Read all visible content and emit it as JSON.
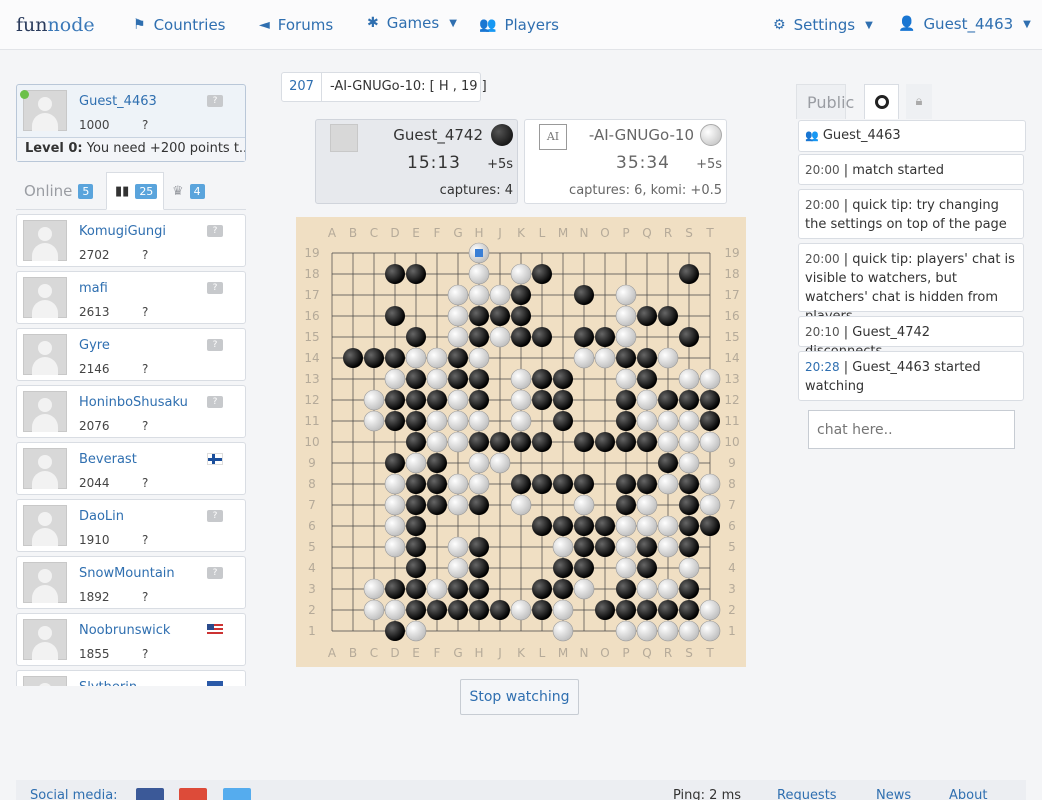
{
  "nav": {
    "logo_a": "fun",
    "logo_b": "node",
    "countries": "Countries",
    "forums": "Forums",
    "games": "Games",
    "players": "Players",
    "settings": "Settings",
    "user": "Guest_4463"
  },
  "me": {
    "name": "Guest_4463",
    "rating": "1000",
    "q": "?",
    "badge": "?",
    "level": "Level 0:",
    "level_text": "You need +200 points t..."
  },
  "tabs": {
    "online": "Online",
    "online_count": "5",
    "ranked_count": "25",
    "crown_count": "4"
  },
  "players": [
    {
      "name": "KomugiGungi",
      "rating": "2702",
      "q": "?",
      "flag": "none"
    },
    {
      "name": "mafi",
      "rating": "2613",
      "q": "?",
      "flag": "none"
    },
    {
      "name": "Gyre",
      "rating": "2146",
      "q": "?",
      "flag": "none"
    },
    {
      "name": "HoninboShusaku",
      "rating": "2076",
      "q": "?",
      "flag": "none"
    },
    {
      "name": "Beverast",
      "rating": "2044",
      "q": "?",
      "flag": "fi"
    },
    {
      "name": "DaoLin",
      "rating": "1910",
      "q": "?",
      "flag": "none"
    },
    {
      "name": "SnowMountain",
      "rating": "1892",
      "q": "?",
      "flag": "none"
    },
    {
      "name": "Noobrunswick",
      "rating": "1855",
      "q": "?",
      "flag": "us"
    },
    {
      "name": "Slytherin",
      "rating": "",
      "q": "",
      "flag": "ua"
    }
  ],
  "game": {
    "move_no": "207",
    "last_move": "-AI-GNUGo-10: [ H , 19 ]",
    "black": {
      "name": "Guest_4742",
      "time": "15:13",
      "inc": "+5s",
      "captures": "captures: 4"
    },
    "white": {
      "name": "-AI-GNUGo-10",
      "time": "35:34",
      "inc": "+5s",
      "captures": "captures: 6, komi: +0.5"
    },
    "stop": "Stop watching",
    "cols": [
      "A",
      "B",
      "C",
      "D",
      "E",
      "F",
      "G",
      "H",
      "J",
      "K",
      "L",
      "M",
      "N",
      "O",
      "P",
      "Q",
      "R",
      "S",
      "T"
    ],
    "rows": [
      "19",
      "18",
      "17",
      "16",
      "15",
      "14",
      "13",
      "12",
      "11",
      "10",
      "9",
      "8",
      "7",
      "6",
      "5",
      "4",
      "3",
      "2",
      "1"
    ],
    "board": [
      "...................",
      "...BB..W.WB......B.",
      "......WWWB..B.W....",
      "...B..WBBB....WBB..",
      "....B.WBWBB.BBW..B.",
      ".BBBWWBW....WWBBW..",
      "...WBWBB.WBB..WB.WWW.",
      "..WBBBWB.WBB..BWBBBB",
      "..WBBWWW.W.B..BWWWBW",
      "....BWWBBBB.BBBBWWWW",
      "...BWB.WW.......BW.W",
      "...WBBWW.BBBB.BBWBWB",
      "...WBBWB.W..W.BW.BW.",
      "...WB.....BBBBWWWBB.",
      "...WB.WB...WBBWBWB..",
      "....B.WB...BB.WB.W..",
      "..WBBWBB..BBW.BWWB..",
      "..WWBBBBBWBW.BBBBBW.",
      "...BW......W..WWWWW."
    ]
  },
  "chat": {
    "tab_public": "Public",
    "user": "Guest_4463",
    "messages": [
      {
        "time": "20:00",
        "text": "match started"
      },
      {
        "time": "20:00",
        "text": "quick tip: try changing the settings on top of the page"
      },
      {
        "time": "20:00",
        "text": "quick tip: players' chat is visible to watchers, but watchers' chat is hidden from players"
      },
      {
        "time": "20:10",
        "text": "Guest_4742 disconnects.."
      },
      {
        "time": "20:28",
        "text": "Guest_4463 started watching"
      }
    ],
    "placeholder": "chat here.."
  },
  "footer": {
    "social": "Social media:",
    "ping": "Ping: 2 ms",
    "requests": "Requests",
    "news": "News",
    "about": "About"
  }
}
